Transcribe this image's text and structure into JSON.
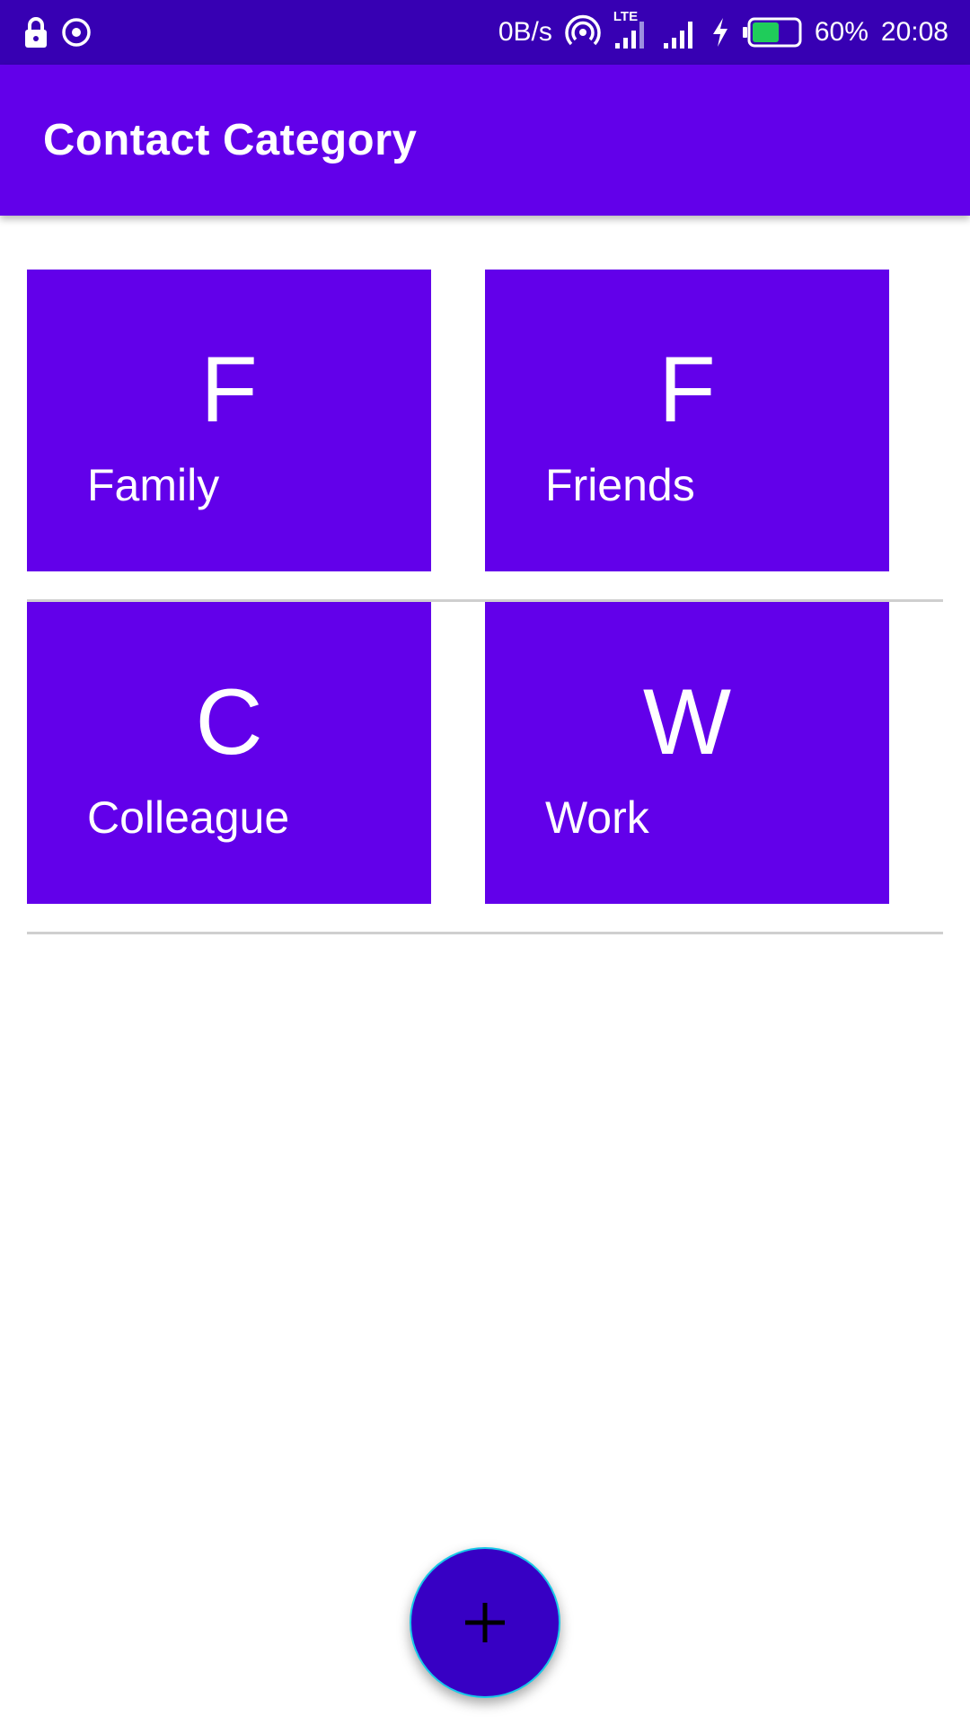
{
  "status_bar": {
    "left_icons": [
      "lock-icon",
      "sync-icon"
    ],
    "net_speed": "0B/s",
    "network_type": "LTE",
    "battery_percent": "60%",
    "time": "20:08",
    "battery_level": 0.6
  },
  "app_bar": {
    "title": "Contact Category",
    "color": "#6200ea"
  },
  "categories": [
    {
      "initial": "F",
      "label": "Family"
    },
    {
      "initial": "F",
      "label": "Friends"
    },
    {
      "initial": "C",
      "label": "Colleague"
    },
    {
      "initial": "W",
      "label": "Work"
    }
  ],
  "fab": {
    "icon": "plus-icon",
    "color": "#3700c4"
  },
  "colors": {
    "status_bar": "#3700b3",
    "tile": "#6200ea",
    "divider": "#cfcfcf",
    "battery_fill": "#1fcc5a"
  }
}
